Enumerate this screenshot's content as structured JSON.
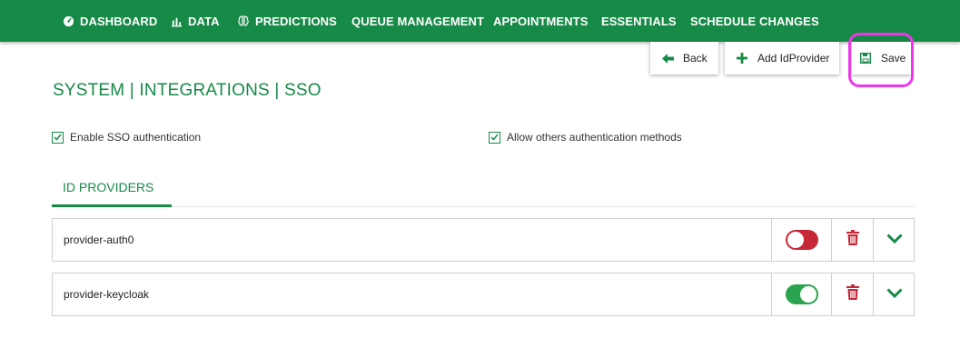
{
  "nav": {
    "items": [
      {
        "label": "DASHBOARD",
        "icon": "dashboard-gauge-icon"
      },
      {
        "label": "DATA",
        "icon": "bar-chart-icon"
      },
      {
        "label": "PREDICTIONS",
        "icon": "brain-icon"
      },
      {
        "label": "QUEUE MANAGEMENT"
      },
      {
        "label": "APPOINTMENTS"
      },
      {
        "label": "ESSENTIALS"
      },
      {
        "label": "SCHEDULE CHANGES"
      }
    ]
  },
  "actions": {
    "back_label": "Back",
    "add_label": "Add IdProvider",
    "save_label": "Save"
  },
  "page": {
    "title": "SYSTEM | INTEGRATIONS | SSO"
  },
  "options": {
    "enable_sso_label": "Enable SSO authentication",
    "enable_sso_checked": true,
    "allow_others_label": "Allow others authentication methods",
    "allow_others_checked": true
  },
  "tabs": {
    "active_label": "ID PROVIDERS"
  },
  "providers": [
    {
      "name": "provider-auth0",
      "enabled": false
    },
    {
      "name": "provider-keycloak",
      "enabled": true
    }
  ],
  "colors": {
    "brand": "#178a48",
    "danger": "#c62838",
    "success": "#2aa44f",
    "highlight": "#ee37e9"
  }
}
